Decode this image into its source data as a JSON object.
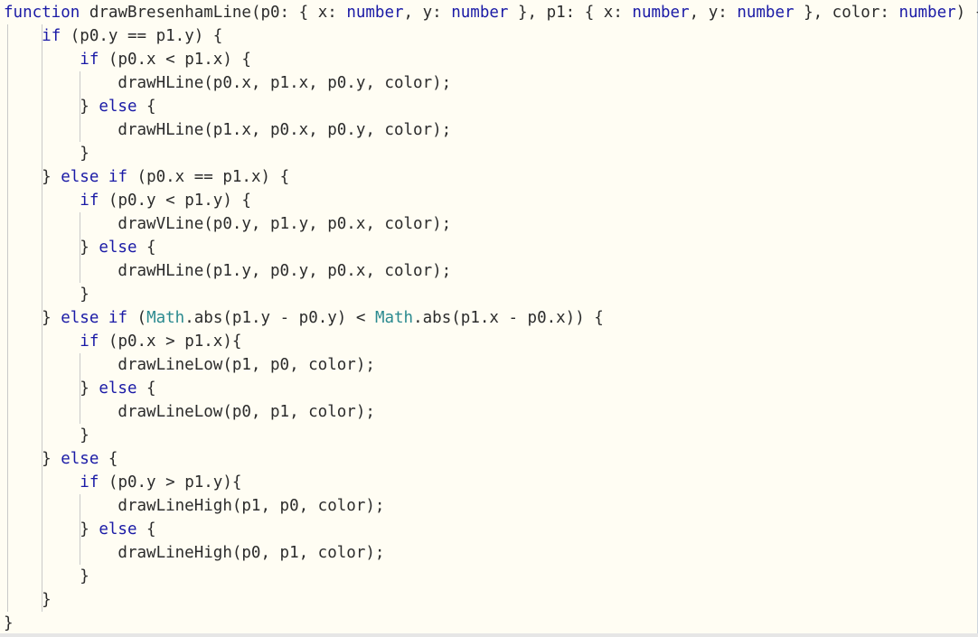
{
  "editor": {
    "language": "typescript",
    "lines": [
      [
        {
          "t": "function",
          "c": "kw"
        },
        {
          "t": " drawBresenhamLine(p0: { x: ",
          "c": "tx"
        },
        {
          "t": "number",
          "c": "ty"
        },
        {
          "t": ", y: ",
          "c": "tx"
        },
        {
          "t": "number",
          "c": "ty"
        },
        {
          "t": " }, p1: { x: ",
          "c": "tx"
        },
        {
          "t": "number",
          "c": "ty"
        },
        {
          "t": ", y: ",
          "c": "tx"
        },
        {
          "t": "number",
          "c": "ty"
        },
        {
          "t": " }, color: ",
          "c": "tx"
        },
        {
          "t": "number",
          "c": "ty"
        },
        {
          "t": ") {",
          "c": "tx"
        }
      ],
      [
        {
          "t": "    ",
          "c": "tx"
        },
        {
          "t": "if",
          "c": "kw"
        },
        {
          "t": " (p0.y == p1.y) {",
          "c": "tx"
        }
      ],
      [
        {
          "t": "        ",
          "c": "tx"
        },
        {
          "t": "if",
          "c": "kw"
        },
        {
          "t": " (p0.x < p1.x) {",
          "c": "tx"
        }
      ],
      [
        {
          "t": "            drawHLine(p0.x, p1.x, p0.y, color);",
          "c": "tx"
        }
      ],
      [
        {
          "t": "        } ",
          "c": "tx"
        },
        {
          "t": "else",
          "c": "kw"
        },
        {
          "t": " {",
          "c": "tx"
        }
      ],
      [
        {
          "t": "            drawHLine(p1.x, p0.x, p0.y, color);",
          "c": "tx"
        }
      ],
      [
        {
          "t": "        }",
          "c": "tx"
        }
      ],
      [
        {
          "t": "    } ",
          "c": "tx"
        },
        {
          "t": "else",
          "c": "kw"
        },
        {
          "t": " ",
          "c": "tx"
        },
        {
          "t": "if",
          "c": "kw"
        },
        {
          "t": " (p0.x == p1.x) {",
          "c": "tx"
        }
      ],
      [
        {
          "t": "        ",
          "c": "tx"
        },
        {
          "t": "if",
          "c": "kw"
        },
        {
          "t": " (p0.y < p1.y) {",
          "c": "tx"
        }
      ],
      [
        {
          "t": "            drawVLine(p0.y, p1.y, p0.x, color);",
          "c": "tx"
        }
      ],
      [
        {
          "t": "        } ",
          "c": "tx"
        },
        {
          "t": "else",
          "c": "kw"
        },
        {
          "t": " {",
          "c": "tx"
        }
      ],
      [
        {
          "t": "            drawHLine(p1.y, p0.y, p0.x, color);",
          "c": "tx"
        }
      ],
      [
        {
          "t": "        }",
          "c": "tx"
        }
      ],
      [
        {
          "t": "    } ",
          "c": "tx"
        },
        {
          "t": "else",
          "c": "kw"
        },
        {
          "t": " ",
          "c": "tx"
        },
        {
          "t": "if",
          "c": "kw"
        },
        {
          "t": " (",
          "c": "tx"
        },
        {
          "t": "Math",
          "c": "cls"
        },
        {
          "t": ".abs(p1.y - p0.y) < ",
          "c": "tx"
        },
        {
          "t": "Math",
          "c": "cls"
        },
        {
          "t": ".abs(p1.x - p0.x)) {",
          "c": "tx"
        }
      ],
      [
        {
          "t": "        ",
          "c": "tx"
        },
        {
          "t": "if",
          "c": "kw"
        },
        {
          "t": " (p0.x > p1.x){",
          "c": "tx"
        }
      ],
      [
        {
          "t": "            drawLineLow(p1, p0, color);",
          "c": "tx"
        }
      ],
      [
        {
          "t": "        } ",
          "c": "tx"
        },
        {
          "t": "else",
          "c": "kw"
        },
        {
          "t": " {",
          "c": "tx"
        }
      ],
      [
        {
          "t": "            drawLineLow(p0, p1, color);",
          "c": "tx"
        }
      ],
      [
        {
          "t": "        }",
          "c": "tx"
        }
      ],
      [
        {
          "t": "    } ",
          "c": "tx"
        },
        {
          "t": "else",
          "c": "kw"
        },
        {
          "t": " {",
          "c": "tx"
        }
      ],
      [
        {
          "t": "        ",
          "c": "tx"
        },
        {
          "t": "if",
          "c": "kw"
        },
        {
          "t": " (p0.y > p1.y){",
          "c": "tx"
        }
      ],
      [
        {
          "t": "            drawLineHigh(p1, p0, color);",
          "c": "tx"
        }
      ],
      [
        {
          "t": "        } ",
          "c": "tx"
        },
        {
          "t": "else",
          "c": "kw"
        },
        {
          "t": " {",
          "c": "tx"
        }
      ],
      [
        {
          "t": "            drawLineHigh(p0, p1, color);",
          "c": "tx"
        }
      ],
      [
        {
          "t": "        }",
          "c": "tx"
        }
      ],
      [
        {
          "t": "    }",
          "c": "tx"
        }
      ],
      [
        {
          "t": "}",
          "c": "tx"
        }
      ]
    ]
  },
  "colors": {
    "background": "#fffdf3",
    "keyword": "#1a1aa6",
    "type": "#1a1aa6",
    "class": "#2b8a8f",
    "text": "#2b2b2b",
    "indent_guide": "#c9c9c9"
  }
}
